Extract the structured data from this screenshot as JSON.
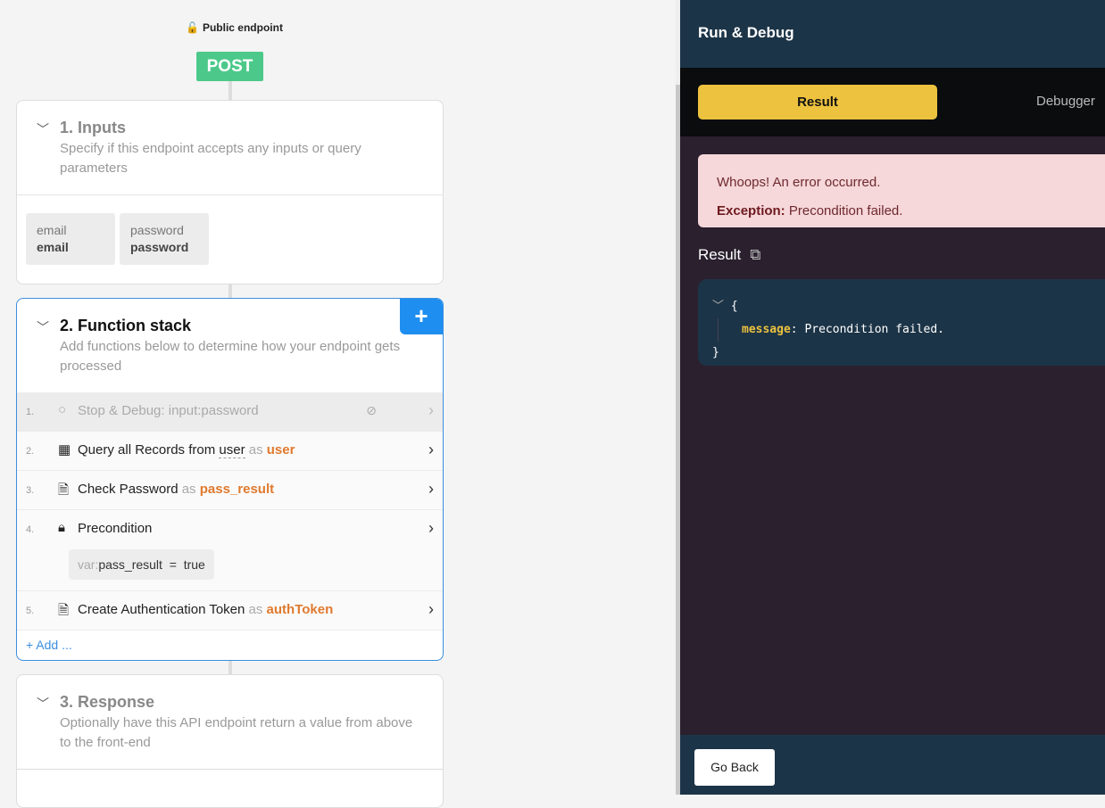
{
  "endpoint": {
    "visibility": "Public endpoint",
    "method": "POST"
  },
  "inputs": {
    "title": "1. Inputs",
    "description": "Specify if this endpoint accepts any inputs or query parameters",
    "fields": [
      {
        "name": "email",
        "type": "email"
      },
      {
        "name": "password",
        "type": "password"
      }
    ]
  },
  "stack": {
    "title": "2. Function stack",
    "description": "Add functions below to determine how your endpoint gets processed",
    "add_label": "Add ...",
    "items": [
      {
        "num": "1.",
        "label": "Stop & Debug: input:password"
      },
      {
        "num": "2.",
        "label": "Query all Records from ",
        "table": "user",
        "as": "as",
        "var": "user"
      },
      {
        "num": "3.",
        "label": "Check Password ",
        "as": "as",
        "var": "pass_result"
      },
      {
        "num": "4.",
        "label": "Precondition",
        "cond_prefix": "var:",
        "cond_var": "pass_result",
        "cond_op": "=",
        "cond_val": "true"
      },
      {
        "num": "5.",
        "label": "Create Authentication Token ",
        "as": "as",
        "var": "authToken"
      }
    ]
  },
  "response": {
    "title": "3. Response",
    "description": "Optionally have this API endpoint return a value from above to the front-end"
  },
  "debug": {
    "title": "Run & Debug",
    "tab_result": "Result",
    "tab_debugger": "Debugger",
    "error_title": "Whoops! An error occurred.",
    "exception_label": "Exception:",
    "exception_msg": "Precondition failed.",
    "result_label": "Result",
    "json_open": "{",
    "json_key": "message",
    "json_value": "Precondition failed.",
    "json_close": "}",
    "go_back": "Go Back"
  }
}
